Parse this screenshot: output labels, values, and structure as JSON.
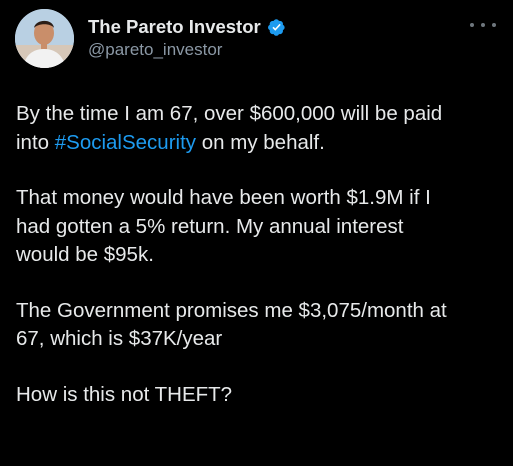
{
  "author": {
    "display_name": "The Pareto Investor",
    "handle": "@pareto_investor",
    "verified": true
  },
  "icons": {
    "verified": "verified-badge-icon",
    "more": "more-options-icon"
  },
  "colors": {
    "background": "#000000",
    "text": "#e7e9ea",
    "secondary_text": "#8b98a5",
    "link": "#1d9bf0",
    "verified_badge": "#1d9bf0"
  },
  "tweet": {
    "p1_l1": "By the time I am 67, over $600,000 will be paid",
    "p1_l2_pre": "into ",
    "p1_hashtag": "#SocialSecurity",
    "p1_l2_post": " on my behalf.",
    "p2_l1": "That money would have been worth $1.9M if I",
    "p2_l2": "had gotten a 5% return. My annual interest",
    "p2_l3": "would be $95k.",
    "p3_l1": "The Government promises me $3,075/month at",
    "p3_l2": "67, which is $37K/year",
    "p4_l1": "How is this not THEFT?"
  }
}
